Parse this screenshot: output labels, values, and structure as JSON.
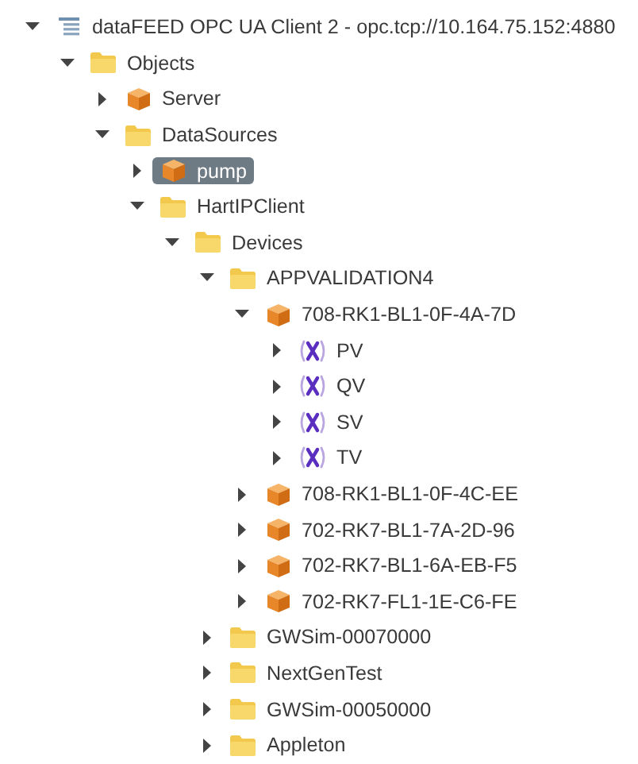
{
  "tree": [
    {
      "label": "dataFEED OPC UA Client 2 - opc.tcp://10.164.75.152:4880",
      "kind": "server",
      "expanded": true,
      "selected": false,
      "children": [
        {
          "label": "Objects",
          "kind": "folder",
          "expanded": true,
          "selected": false,
          "children": [
            {
              "label": "Server",
              "kind": "object",
              "expanded": false,
              "selected": false
            },
            {
              "label": "DataSources",
              "kind": "folder",
              "expanded": true,
              "selected": false,
              "children": [
                {
                  "label": "pump",
                  "kind": "object",
                  "expanded": false,
                  "selected": true
                },
                {
                  "label": "HartIPClient",
                  "kind": "folder",
                  "expanded": true,
                  "selected": false,
                  "children": [
                    {
                      "label": "Devices",
                      "kind": "folder",
                      "expanded": true,
                      "selected": false,
                      "children": [
                        {
                          "label": "APPVALIDATION4",
                          "kind": "folder",
                          "expanded": true,
                          "selected": false,
                          "children": [
                            {
                              "label": "708-RK1-BL1-0F-4A-7D",
                              "kind": "object",
                              "expanded": true,
                              "selected": false,
                              "children": [
                                {
                                  "label": "PV",
                                  "kind": "variable",
                                  "expanded": false,
                                  "selected": false
                                },
                                {
                                  "label": "QV",
                                  "kind": "variable",
                                  "expanded": false,
                                  "selected": false
                                },
                                {
                                  "label": "SV",
                                  "kind": "variable",
                                  "expanded": false,
                                  "selected": false
                                },
                                {
                                  "label": "TV",
                                  "kind": "variable",
                                  "expanded": false,
                                  "selected": false
                                }
                              ]
                            },
                            {
                              "label": "708-RK1-BL1-0F-4C-EE",
                              "kind": "object",
                              "expanded": false,
                              "selected": false
                            },
                            {
                              "label": "702-RK7-BL1-7A-2D-96",
                              "kind": "object",
                              "expanded": false,
                              "selected": false
                            },
                            {
                              "label": "702-RK7-BL1-6A-EB-F5",
                              "kind": "object",
                              "expanded": false,
                              "selected": false
                            },
                            {
                              "label": "702-RK7-FL1-1E-C6-FE",
                              "kind": "object",
                              "expanded": false,
                              "selected": false
                            }
                          ]
                        },
                        {
                          "label": "GWSim-00070000",
                          "kind": "folder",
                          "expanded": false,
                          "selected": false
                        },
                        {
                          "label": "NextGenTest",
                          "kind": "folder",
                          "expanded": false,
                          "selected": false
                        },
                        {
                          "label": "GWSim-00050000",
                          "kind": "folder",
                          "expanded": false,
                          "selected": false
                        },
                        {
                          "label": "Appleton",
                          "kind": "folder",
                          "expanded": false,
                          "selected": false
                        }
                      ]
                    }
                  ]
                }
              ]
            }
          ]
        }
      ]
    }
  ]
}
